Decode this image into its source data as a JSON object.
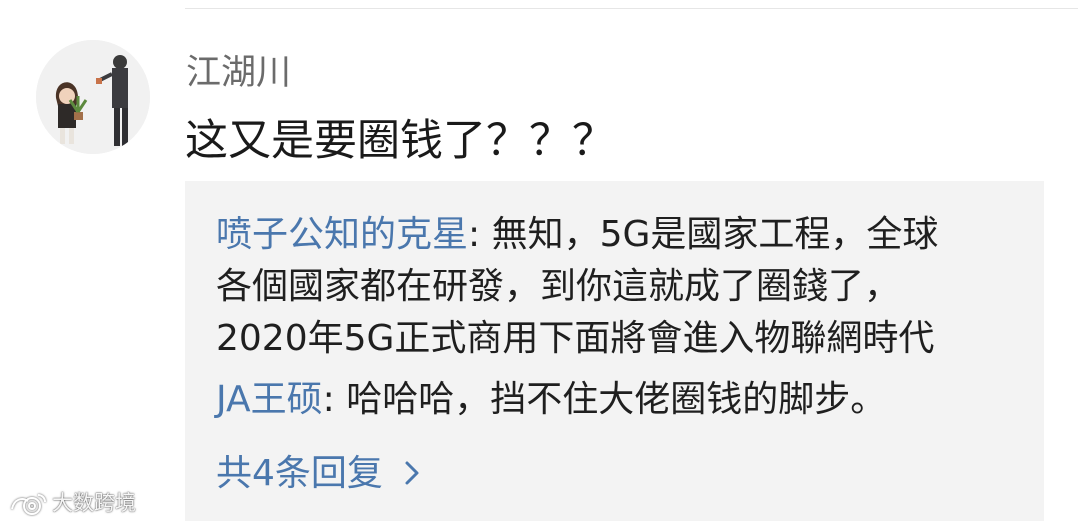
{
  "comment": {
    "username": "江湖川",
    "text": "这又是要圈钱了？？？"
  },
  "replies": [
    {
      "author": "喷子公知的克星",
      "lines": [
        "無知，5G是國家工程，全球",
        "各個國家都在研發，到你這就成了圈錢了，",
        "2020年5G正式商用下面將會進入物聯網時代"
      ]
    },
    {
      "author": "JA王硕",
      "lines": [
        "哈哈哈，挡不住大佬圈钱的脚步。"
      ]
    }
  ],
  "more_replies_label": "共4条回复",
  "watermark_text": "大数跨境",
  "colors": {
    "link": "#4a77ad",
    "reply_bg": "#f3f3f3",
    "text": "#1a1a1a",
    "username": "#6b6b6b"
  },
  "icons": {
    "more": "chevron-right-icon",
    "watermark": "weibo-logo-icon"
  }
}
